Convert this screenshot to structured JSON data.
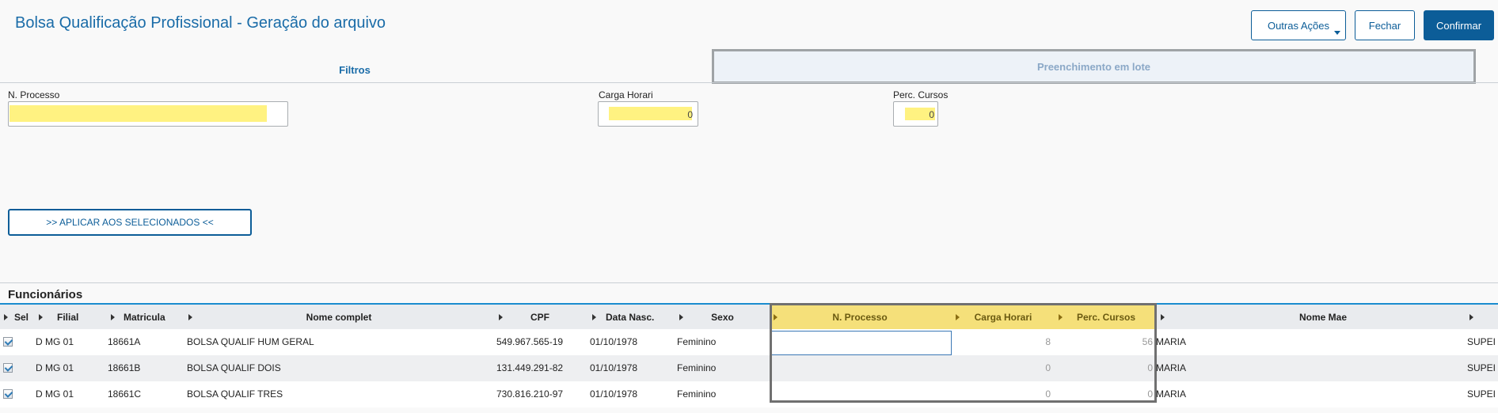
{
  "header": {
    "title": "Bolsa Qualificação Profissional - Geração do arquivo",
    "other_actions_label": "Outras Ações",
    "close_label": "Fechar",
    "confirm_label": "Confirmar"
  },
  "tabs": [
    {
      "label": "Filtros"
    },
    {
      "label": "Preenchimento em lote"
    }
  ],
  "form": {
    "processo": {
      "label": "N. Processo",
      "value": ""
    },
    "carga": {
      "label": "Carga Horari",
      "value": "0"
    },
    "perc": {
      "label": "Perc. Cursos",
      "value": "0"
    },
    "apply_label": ">> APLICAR AOS SELECIONADOS <<"
  },
  "section_title": "Funcionários",
  "table": {
    "columns": [
      "Sel",
      "Filial",
      "Matricula",
      "Nome complet",
      "CPF",
      "Data Nasc.",
      "Sexo",
      "N. Processo",
      "Carga Horari",
      "Perc. Cursos",
      "Nome Mae"
    ],
    "rows": [
      {
        "sel": true,
        "filial": "D MG 01",
        "matricula": "18661A",
        "nome": "BOLSA QUALIF HUM GERAL",
        "cpf": "549.967.565-19",
        "nasc": "01/10/1978",
        "sexo": "Feminino",
        "processo": "",
        "carga": "8",
        "perc": "56",
        "mae": "MARIA",
        "extra": "SUPEI"
      },
      {
        "sel": true,
        "filial": "D MG 01",
        "matricula": "18661B",
        "nome": "BOLSA QUALIF DOIS",
        "cpf": "131.449.291-82",
        "nasc": "01/10/1978",
        "sexo": "Feminino",
        "processo": "",
        "carga": "0",
        "perc": "0",
        "mae": "MARIA",
        "extra": "SUPEI"
      },
      {
        "sel": true,
        "filial": "D MG 01",
        "matricula": "18661C",
        "nome": "BOLSA QUALIF TRES",
        "cpf": "730.816.210-97",
        "nasc": "01/10/1978",
        "sexo": "Feminino",
        "processo": "",
        "carga": "0",
        "perc": "0",
        "mae": "MARIA",
        "extra": "SUPEI"
      }
    ]
  },
  "colors": {
    "accent": "#0c5d98",
    "highlight": "#fff281",
    "header_yellow": "#f5e07a"
  }
}
